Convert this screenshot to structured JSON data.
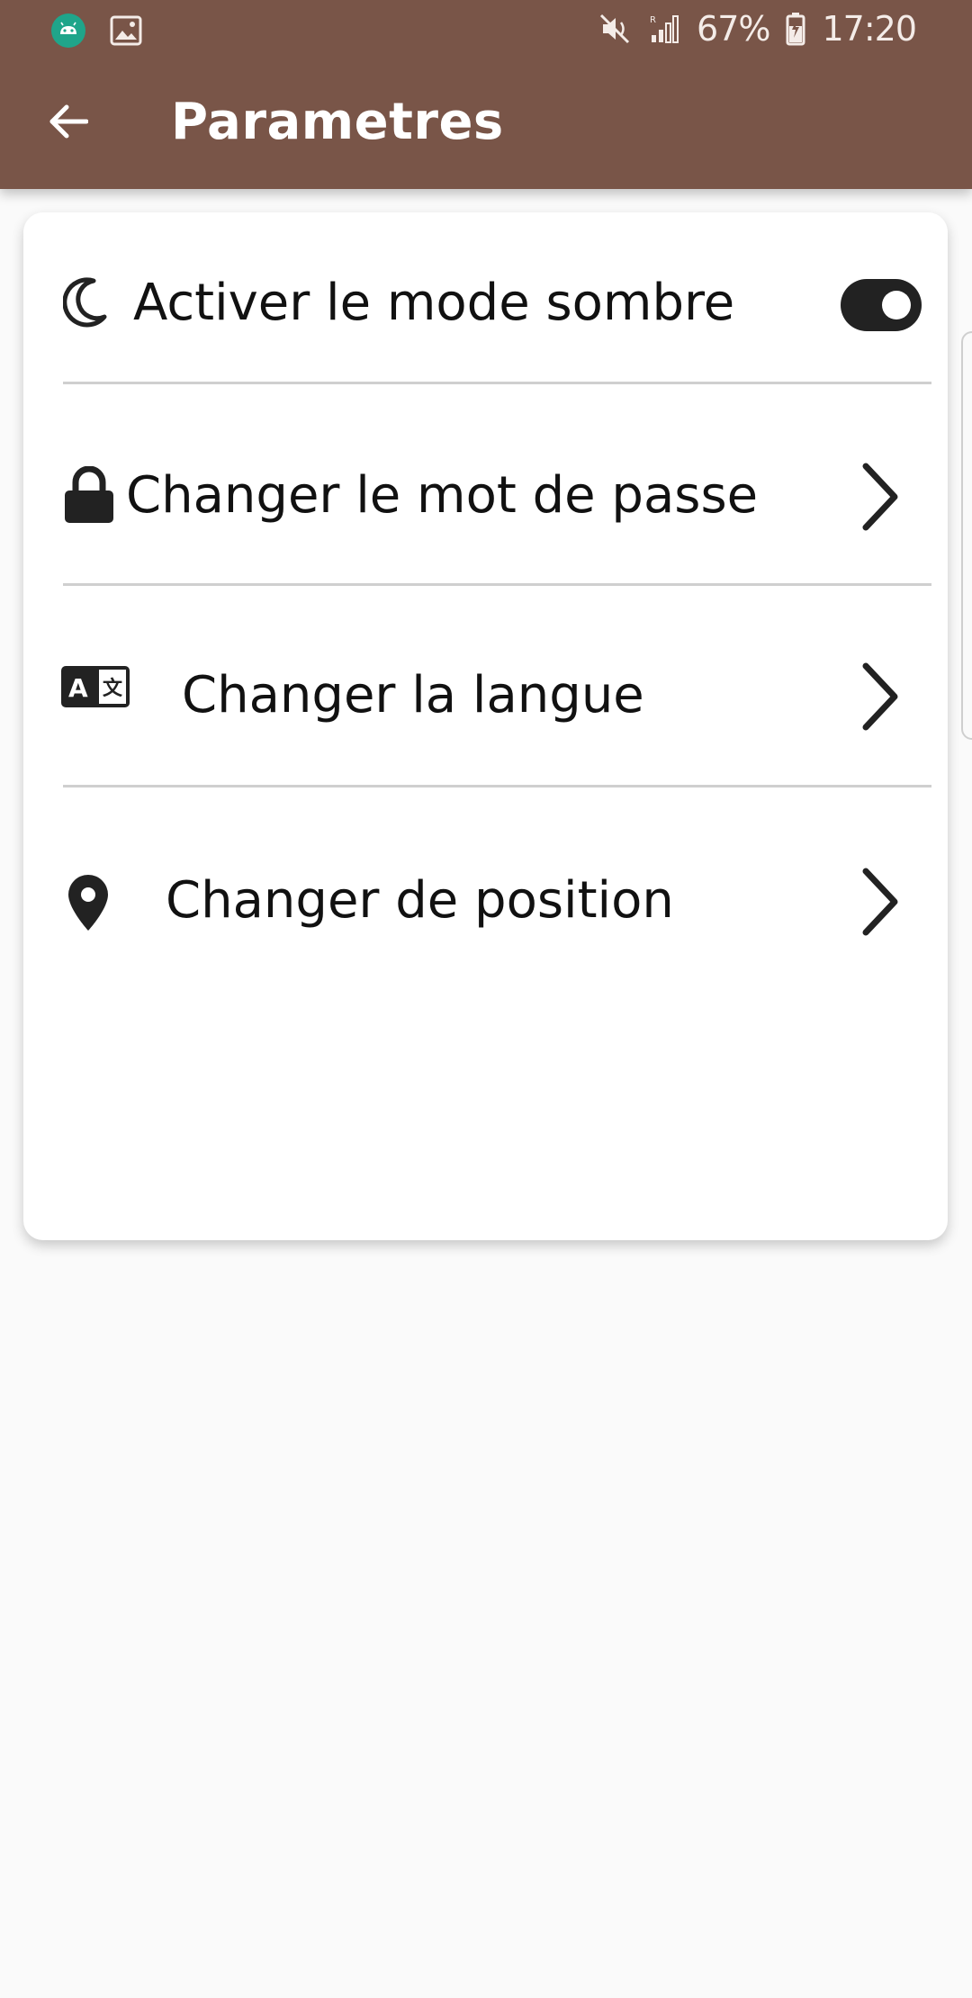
{
  "status_bar": {
    "battery": "67%",
    "time": "17:20",
    "icons": [
      "android-debug-icon",
      "image-icon",
      "mute-icon",
      "signal-icon",
      "battery-charging-icon"
    ]
  },
  "header": {
    "title": "Parametres",
    "back_icon": "arrow-left-icon"
  },
  "settings": {
    "dark_mode": {
      "label": "Activer le mode sombre",
      "icon": "moon-icon",
      "enabled": true
    },
    "items": [
      {
        "label": "Changer le mot de passe",
        "icon": "lock-icon"
      },
      {
        "label": "Changer la langue",
        "icon": "translate-icon"
      },
      {
        "label": "Changer de position",
        "icon": "location-pin-icon"
      }
    ]
  },
  "colors": {
    "header": "#795548",
    "background": "#fafafa",
    "card": "#ffffff",
    "toggle_on": "#222222",
    "divider": "#cfcfcf"
  }
}
